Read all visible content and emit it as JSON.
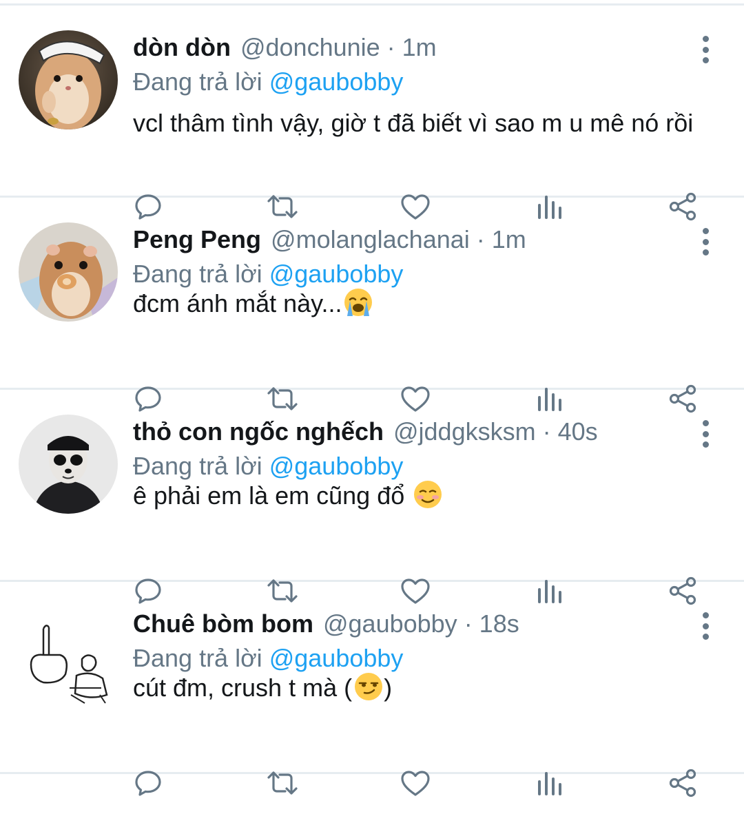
{
  "replying_prefix": "Đang trả lời",
  "tweets": [
    {
      "name": "dòn dòn",
      "handle": "@donchunie",
      "time": "· 1m",
      "reply_to": "@gaubobby",
      "text": "vcl thâm tình vậy, giờ t đã biết vì sao m u mê nó rồi",
      "emoji": "",
      "avatar": "hamster-avatar"
    },
    {
      "name": "Peng Peng",
      "handle": "@molanglachanai",
      "time": "· 1m",
      "reply_to": "@gaubobby",
      "text": "đcm ánh mắt này...",
      "emoji": "loudly-crying-face-emoji",
      "avatar": "hamster-eating-avatar"
    },
    {
      "name": "thỏ con ngốc nghếch",
      "handle": "@jddgksksm",
      "time": "· 40s",
      "reply_to": "@gaubobby",
      "text": "ê phải em là em cũng đổ",
      "emoji": "smiling-face-emoji",
      "avatar": "panda-face-person-avatar"
    },
    {
      "name": "Chuê bòm bom",
      "handle": "@gaubobby",
      "time": "· 18s",
      "reply_to": "@gaubobby",
      "text": "cút đm, crush t mà (",
      "text_after": ")",
      "emoji": "smirking-face-emoji",
      "avatar": "sketch-drawing-avatar"
    }
  ],
  "icons": [
    "reply-icon",
    "retweet-icon",
    "like-icon",
    "analytics-icon",
    "share-icon",
    "more-options-icon"
  ],
  "colors": {
    "text": "#14171a",
    "secondary": "#657786",
    "link": "#1da1f2",
    "divider": "#e6ecf0"
  }
}
